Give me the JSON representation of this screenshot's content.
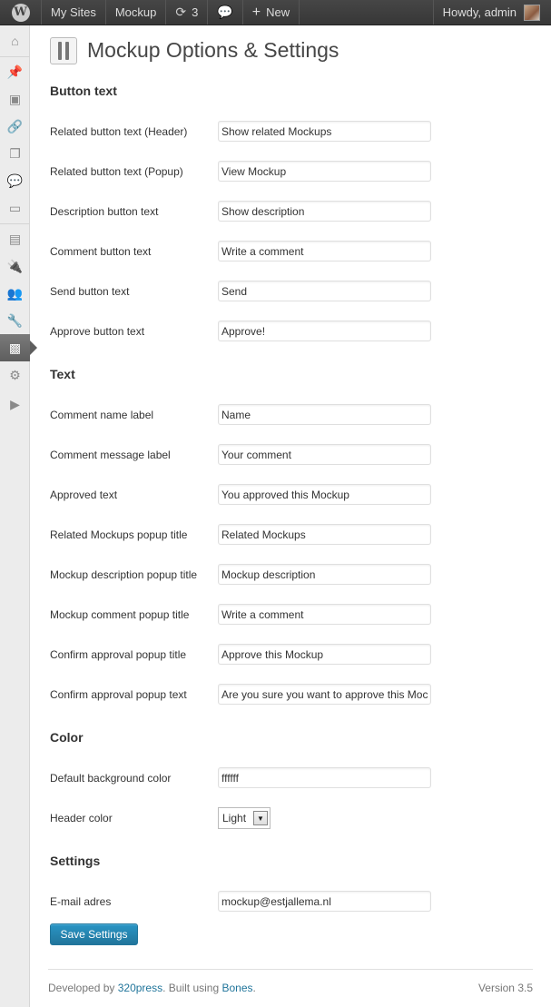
{
  "adminbar": {
    "my_sites": "My Sites",
    "site": "Mockup",
    "updates_count": "3",
    "new_label": "New",
    "howdy": "Howdy, admin"
  },
  "sidebar": {
    "icons": [
      "dashboard-icon",
      "posts-icon",
      "media-icon",
      "links-icon",
      "pages-icon",
      "comments-icon",
      "mockups-icon",
      "appearance-icon",
      "plugins-icon",
      "users-icon",
      "tools-icon",
      "mockup-settings-icon",
      "settings-icon",
      "collapse-menu-icon"
    ]
  },
  "page": {
    "title": "Mockup Options & Settings"
  },
  "sections": {
    "button_text": "Button text",
    "text": "Text",
    "color": "Color",
    "settings": "Settings"
  },
  "fields": [
    {
      "label": "Related button text (Header)",
      "value": "Show related Mockups"
    },
    {
      "label": "Related button text (Popup)",
      "value": "View Mockup"
    },
    {
      "label": "Description button text",
      "value": "Show description"
    },
    {
      "label": "Comment button text",
      "value": "Write a comment"
    },
    {
      "label": "Send button text",
      "value": "Send"
    },
    {
      "label": "Approve button text",
      "value": "Approve!"
    },
    {
      "label": "Comment name label",
      "value": "Name"
    },
    {
      "label": "Comment message label",
      "value": "Your comment"
    },
    {
      "label": "Approved text",
      "value": "You approved this Mockup"
    },
    {
      "label": "Related Mockups popup title",
      "value": "Related Mockups"
    },
    {
      "label": "Mockup description popup title",
      "value": "Mockup description"
    },
    {
      "label": "Mockup comment popup title",
      "value": "Write a comment"
    },
    {
      "label": "Confirm approval popup title",
      "value": "Approve this Mockup"
    },
    {
      "label": "Confirm approval popup text",
      "value": "Are you sure you want to approve this Moc"
    },
    {
      "label": "Default background color",
      "value": "ffffff"
    },
    {
      "label": "Header color",
      "value": "Light"
    },
    {
      "label": "E-mail adres",
      "value": "mockup@estjallema.nl"
    }
  ],
  "save_label": "Save Settings",
  "footer": {
    "developed_by": "Developed by",
    "press_link": "320press",
    "built_using": ". Built using",
    "bones_link": "Bones",
    "period": ".",
    "version": "Version 3.5"
  },
  "colors": {
    "adminbar_bg": "#464646",
    "primary_button": "#21759b",
    "link": "#21759b"
  }
}
